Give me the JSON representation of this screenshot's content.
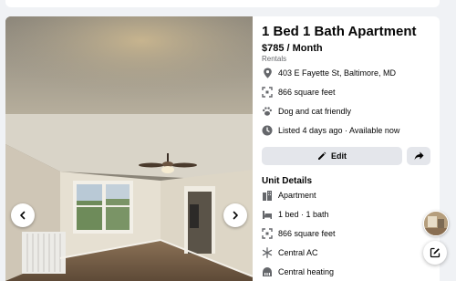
{
  "listing": {
    "title": "1 Bed 1 Bath Apartment",
    "price": "$785 / Month",
    "category": "Rentals",
    "meta": {
      "address": "403 E Fayette St, Baltimore, MD",
      "size": "866 square feet",
      "pets": "Dog and cat friendly",
      "listed": "Listed 4 days ago · Available now"
    }
  },
  "actions": {
    "edit_label": "Edit"
  },
  "unit_details": {
    "heading": "Unit Details",
    "items": [
      {
        "icon": "building-icon",
        "label": "Apartment"
      },
      {
        "icon": "bed-icon",
        "label": "1 bed · 1 bath"
      },
      {
        "icon": "ruler-icon",
        "label": "866 square feet"
      },
      {
        "icon": "snowflake-icon",
        "label": "Central AC"
      },
      {
        "icon": "heating-icon",
        "label": "Central heating"
      }
    ]
  },
  "colors": {
    "page_background": "#f0f2f5",
    "button_background": "#e4e6eb",
    "icon_gray": "#65676b"
  }
}
